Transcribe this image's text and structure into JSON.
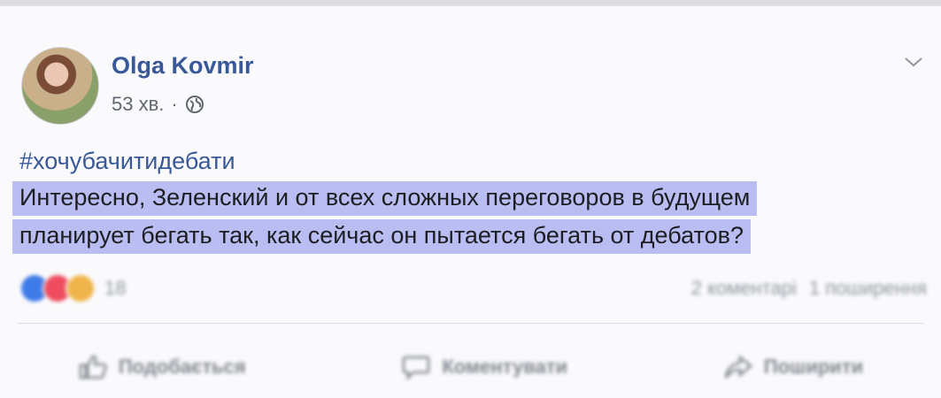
{
  "post": {
    "author": "Olga Kovmir",
    "time": "53 хв.",
    "separator": "·",
    "privacy_icon": "globe-icon",
    "hashtag": "#хочубачитидебати",
    "text_lines": [
      "Интересно, Зеленский и от всех сложных переговоров в будущем",
      "планирует бегать так, как сейчас он пытается бегать от дебатов?"
    ]
  },
  "engagement": {
    "reaction_count": "18",
    "comments": "2 коментарі",
    "shares": "1 поширення"
  },
  "actions": {
    "like": "Подобається",
    "comment": "Коментувати",
    "share": "Поширити"
  },
  "colors": {
    "author_link": "#385898",
    "highlight": "#b9bdf2",
    "muted_text": "#616770"
  }
}
